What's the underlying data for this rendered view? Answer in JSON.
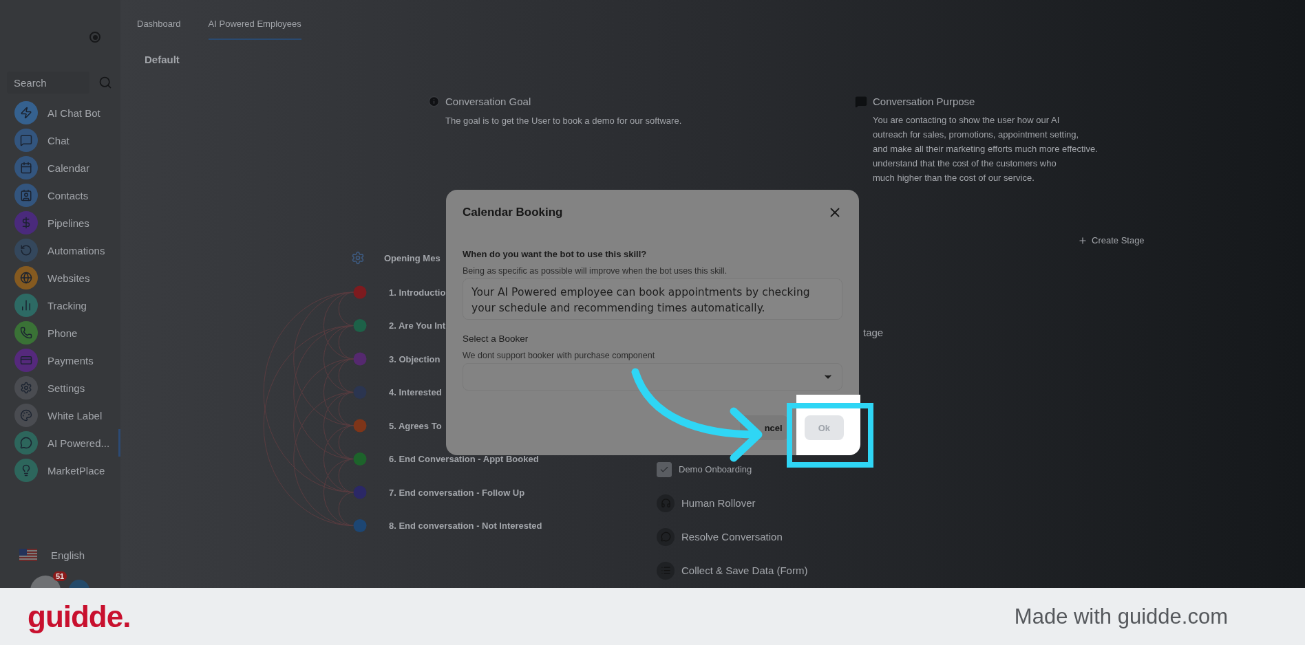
{
  "sidebar": {
    "search": {
      "placeholder": "Search"
    },
    "items": [
      {
        "label": "AI Chat Bot",
        "color": "#35618f",
        "selected": false
      },
      {
        "label": "Chat",
        "color": "#33557e",
        "selected": false
      },
      {
        "label": "Calendar",
        "color": "#33557e",
        "selected": false
      },
      {
        "label": "Contacts",
        "color": "#33557e",
        "selected": false
      },
      {
        "label": "Pipelines",
        "color": "#4a2a7c",
        "selected": false
      },
      {
        "label": "Automations",
        "color": "#34475c",
        "selected": false
      },
      {
        "label": "Websites",
        "color": "#855a20",
        "selected": false
      },
      {
        "label": "Tracking",
        "color": "#2d6a64",
        "selected": false
      },
      {
        "label": "Phone",
        "color": "#3a7236",
        "selected": false
      },
      {
        "label": "Payments",
        "color": "#55297c",
        "selected": false
      },
      {
        "label": "Settings",
        "color": "#4a4c51",
        "selected": false
      },
      {
        "label": "White Label",
        "color": "#4a4c51",
        "selected": false
      },
      {
        "label": "AI Powered...",
        "color": "#2d665c",
        "selected": true
      },
      {
        "label": "MarketPlace",
        "color": "#2d665c",
        "selected": false
      }
    ],
    "language": "English",
    "notification_count": "51"
  },
  "tabs": [
    {
      "label": "Dashboard",
      "selected": false
    },
    {
      "label": "AI Powered Employees",
      "selected": true
    }
  ],
  "section_title": "Default",
  "goal": {
    "title": "Conversation Goal",
    "text": "The goal is to get the User to book a demo for our software."
  },
  "purpose": {
    "title": "Conversation Purpose",
    "lines": [
      "You are contacting to show the user how our AI",
      "outreach for sales, promotions, appointment setting,",
      "and make all their marketing efforts much more effective.",
      "understand that the cost of the customers who",
      "much higher than the cost of our service."
    ]
  },
  "create_stage": "Create Stage",
  "stages": {
    "header": "Opening Mes",
    "items": [
      {
        "label": "1. Introductio",
        "color": "#7d1b1f"
      },
      {
        "label": "2. Are You Int",
        "color": "#1d6148"
      },
      {
        "label": "3. Objection",
        "color": "#55296f"
      },
      {
        "label": "4. Interested",
        "color": "#2b3550"
      },
      {
        "label": "5. Agrees To",
        "color": "#7e3519"
      },
      {
        "label": "6. End Conversation - Appt Booked",
        "color": "#1d632b"
      },
      {
        "label": "7. End conversation - Follow Up",
        "color": "#2b2866"
      },
      {
        "label": "8. End conversation - Not Interested",
        "color": "#1d4673"
      }
    ]
  },
  "skills": {
    "heading": "tage",
    "items": [
      {
        "kind": "checkbox",
        "label": "Demo Onboarding",
        "checked": true
      },
      {
        "kind": "icon",
        "label": "Human Rollover"
      },
      {
        "kind": "icon",
        "label": "Resolve Conversation"
      },
      {
        "kind": "icon",
        "label": "Collect & Save Data (Form)"
      }
    ]
  },
  "dialog": {
    "title": "Calendar Booking",
    "question": "When do you want the bot to use this skill?",
    "hint": "Being as specific as possible will improve when the bot uses this skill.",
    "answer": "Your AI Powered employee can book appointments by checking your schedule and recommending times automatically.",
    "booker_label": "Select a Booker",
    "booker_hint": "We dont support booker with purchase component",
    "buttons": [
      {
        "kind": "secondary",
        "label": "ncel",
        "disabled": false
      },
      {
        "kind": "primary",
        "label": "Ok",
        "disabled": true
      }
    ]
  },
  "footer": {
    "logo": "guidde.",
    "caption": "Made with guidde.com"
  }
}
